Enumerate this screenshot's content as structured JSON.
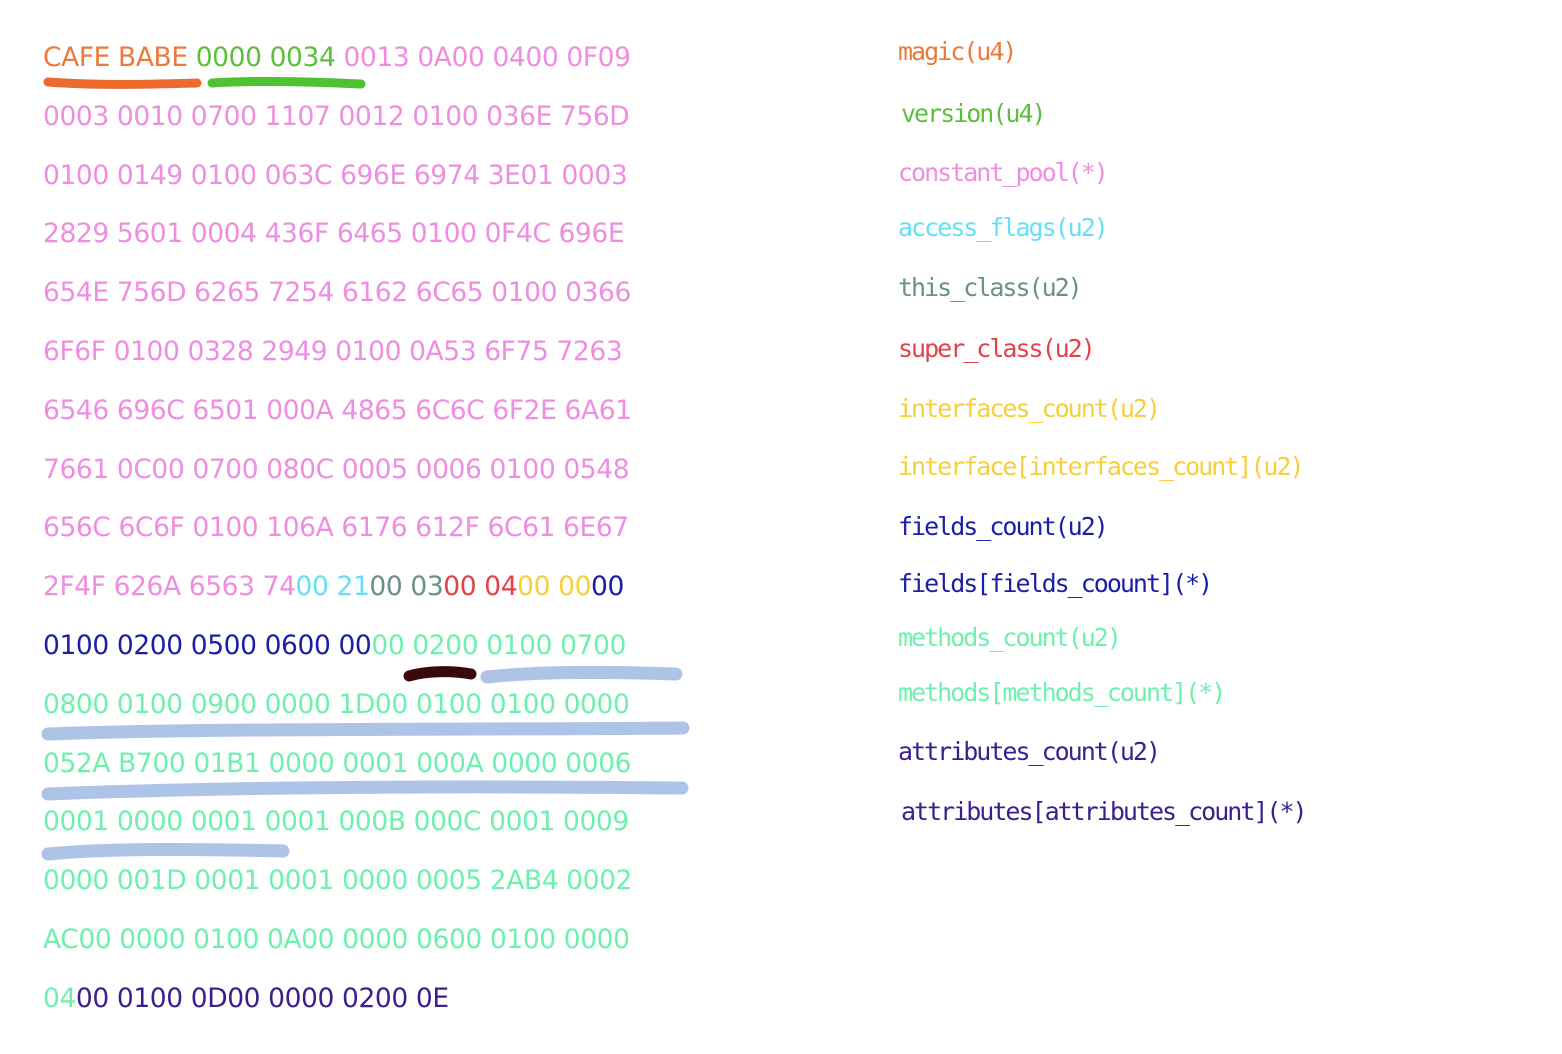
{
  "colors": {
    "magic": "#ec7a3c",
    "version": "#5cbf3c",
    "cp": "#ee8ee0",
    "access": "#66dff4",
    "this": "#6b8f8b",
    "super": "#e4424b",
    "icount": "#f6cf3c",
    "fcount": "#1c1fa6",
    "methods": "#6ef0ae",
    "attrs": "#3c1f8c",
    "mark_orange": "#ec6a30",
    "mark_green": "#4fc233",
    "mark_dark": "#3a0a0a",
    "mark_blue": "#aec3e8"
  },
  "hex_lines": [
    [
      {
        "t": "CAFE BABE",
        "c": "magic"
      },
      {
        "t": " ",
        "c": "cp"
      },
      {
        "t": "0000 0034",
        "c": "version"
      },
      {
        "t": " 0013 0A00 0400 0F09",
        "c": "cp"
      }
    ],
    [
      {
        "t": "0003 0010 0700 1107 0012 0100 036E 756D",
        "c": "cp"
      }
    ],
    [
      {
        "t": "0100 0149 0100 063C 696E 6974 3E01 0003",
        "c": "cp"
      }
    ],
    [
      {
        "t": "2829 5601 0004 436F 6465 0100 0F4C 696E",
        "c": "cp"
      }
    ],
    [
      {
        "t": "654E 756D 6265 7254 6162 6C65 0100 0366",
        "c": "cp"
      }
    ],
    [
      {
        "t": "6F6F 0100 0328 2949 0100 0A53 6F75 7263",
        "c": "cp"
      }
    ],
    [
      {
        "t": "6546 696C 6501 000A 4865 6C6C 6F2E 6A61",
        "c": "cp"
      }
    ],
    [
      {
        "t": "7661 0C00 0700 080C 0005 0006 0100 0548",
        "c": "cp"
      }
    ],
    [
      {
        "t": "656C 6C6F 0100 106A 6176 612F 6C61 6E67",
        "c": "cp"
      }
    ],
    [
      {
        "t": "2F4F 626A 6563 74",
        "c": "cp"
      },
      {
        "t": "00 21",
        "c": "access"
      },
      {
        "t": "00 03",
        "c": "this"
      },
      {
        "t": "00 ",
        "c": "super"
      },
      {
        "t": "04",
        "c": "super"
      },
      {
        "t": "00 ",
        "c": "icount"
      },
      {
        "t": "00",
        "c": "icount"
      },
      {
        "t": "00",
        "c": "fcount"
      }
    ],
    [
      {
        "t": "0100 0200 0500 0600 00",
        "c": "fcount"
      },
      {
        "t": "00 0200 0100 0700",
        "c": "methods"
      }
    ],
    [
      {
        "t": "0800 0100 0900 0000 1D00 0100 0100 0000",
        "c": "methods"
      }
    ],
    [
      {
        "t": "052A B700 01B1 0000 0001 000A 0000 0006",
        "c": "methods"
      }
    ],
    [
      {
        "t": "0001 0000 0001 0001 000B 000C 0001 0009",
        "c": "methods"
      }
    ],
    [
      {
        "t": "0000 001D 0001 0001 0000 0005 2AB4 0002",
        "c": "methods"
      }
    ],
    [
      {
        "t": "AC00 0000 0100 0A00 0000 0600 0100 0000",
        "c": "methods"
      }
    ],
    [
      {
        "t": "04",
        "c": "methods"
      },
      {
        "t": "00 0100 0D00 0000 0200 0E",
        "c": "attrs"
      }
    ]
  ],
  "legend": [
    {
      "label": "magic(u4)",
      "c": "magic"
    },
    {
      "label": "version(u4)",
      "c": "version"
    },
    {
      "label": "constant_pool(*)",
      "c": "cp"
    },
    {
      "label": "access_flags(u2)",
      "c": "access"
    },
    {
      "label": "this_class(u2)",
      "c": "this"
    },
    {
      "label": "super_class(u2)",
      "c": "super"
    },
    {
      "label": "interfaces_count(u2)",
      "c": "icount"
    },
    {
      "label": "interface[interfaces_count](u2)",
      "c": "icount"
    },
    {
      "label": "fields_count(u2)",
      "c": "fcount"
    },
    {
      "label": "fields[fields_coount](*)",
      "c": "fcount"
    },
    {
      "label": "methods_count(u2)",
      "c": "methods"
    },
    {
      "label": "methods[methods_count](*)",
      "c": "methods"
    },
    {
      "label": "attributes_count(u2)",
      "c": "attrs"
    },
    {
      "label": "attributes[attributes_count](*)",
      "c": "attrs"
    }
  ]
}
